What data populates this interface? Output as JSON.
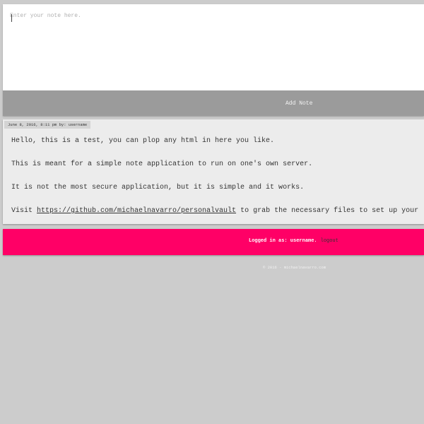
{
  "composer": {
    "placeholder": "Enter your note here.",
    "add_label": "Add Note"
  },
  "note": {
    "meta": "June 8, 2016, 8:11 pm by: username",
    "paragraphs": [
      "Hello, this is a test, you can plop any html in here you like.",
      "This is meant for a simple note application to run on one's own server.",
      "It is not the most secure application, but it is simple and it works."
    ],
    "visit_prefix": "Visit ",
    "link_text": "https://github.com/michaelnavarro/personalvault",
    "visit_suffix": " to grab the necessary files to set up your"
  },
  "status": {
    "logged_in_text": "Logged in as: username.",
    "logout_label": "logout",
    "color": "#ff0066"
  },
  "footer": {
    "text": "© 2016 - michaelnavarro.com"
  }
}
